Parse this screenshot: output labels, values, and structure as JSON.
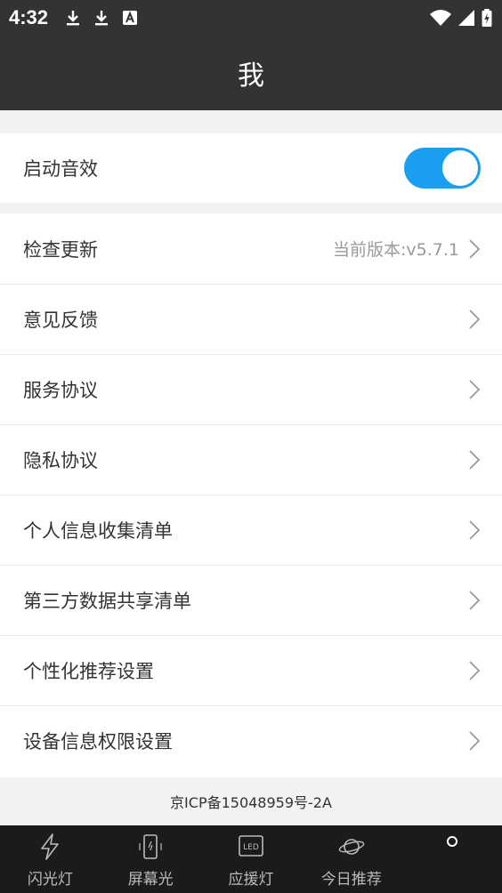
{
  "status_bar": {
    "time": "4:32",
    "left_icons": [
      "download-icon",
      "download-icon",
      "font-a-icon"
    ],
    "right_icons": [
      "wifi-icon",
      "signal-icon",
      "battery-charging-icon"
    ]
  },
  "header": {
    "title": "我"
  },
  "sound_setting": {
    "label": "启动音效",
    "enabled": true,
    "toggle_color": "#1a9ff0"
  },
  "menu": {
    "items": [
      {
        "label": "检查更新",
        "value": "当前版本:v5.7.1"
      },
      {
        "label": "意见反馈",
        "value": ""
      },
      {
        "label": "服务协议",
        "value": ""
      },
      {
        "label": "隐私协议",
        "value": ""
      },
      {
        "label": "个人信息收集清单",
        "value": ""
      },
      {
        "label": "第三方数据共享清单",
        "value": ""
      },
      {
        "label": "个性化推荐设置",
        "value": ""
      },
      {
        "label": "设备信息权限设置",
        "value": ""
      }
    ]
  },
  "footer": {
    "icp": "京ICP备15048959号-2A"
  },
  "bottom_nav": {
    "items": [
      {
        "label": "闪光灯",
        "icon": "lightning-icon"
      },
      {
        "label": "屏幕光",
        "icon": "phone-screen-icon"
      },
      {
        "label": "应援灯",
        "icon": "led-icon"
      },
      {
        "label": "今日推荐",
        "icon": "planet-icon"
      },
      {
        "label": "",
        "icon": "profile-icon"
      }
    ]
  },
  "colors": {
    "header_bg": "#333333",
    "page_bg": "#f2f2f2",
    "nav_bg": "#1b1b1b",
    "accent": "#1a9ff0"
  }
}
